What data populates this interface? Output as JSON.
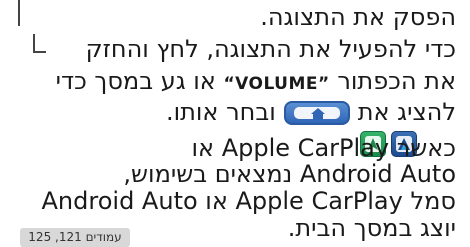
{
  "instructions": {
    "line1": "הפסק את התצוגה.",
    "line2": "כדי להפעיל את התצוגה, לחץ והחזק",
    "line3_prefix": "את הכפתור ",
    "line3_button": "”VOLUME“",
    "line3_suffix": " או גע במסך כדי",
    "line4_prefix": "להציג את",
    "line4_suffix": "ובחר אותו."
  },
  "carplay_note": {
    "line5": "כאשר Apple CarPlay או",
    "line6": "Android Auto נמצאים בשימוש,",
    "line7": "סמל Apple CarPlay או Android Auto",
    "line8": "יוצג במסך הבית."
  },
  "page_reference": "עמודים 121, 125",
  "icons": [
    "android-auto-icon",
    "apple-carplay-icon",
    "home-button-icon"
  ],
  "colors": {
    "text": "#1a1a1a",
    "home_button_blue": "#2f66b6",
    "android_auto_green": "#1b8a4b",
    "carplay_blue": "#1d4a8c",
    "reference_tab_gray": "#d8d8d8"
  }
}
